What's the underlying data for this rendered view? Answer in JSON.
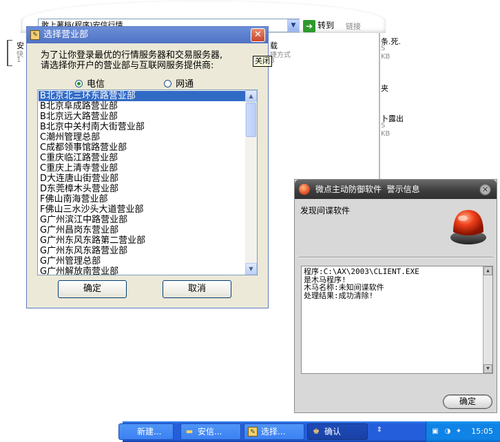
{
  "background": {
    "address_value": "敢上著档(程序)安信行情",
    "go_label": "转到",
    "links_label": "链接",
    "left_text_1": "安",
    "left_text_2": "快",
    "left_text_3": "1",
    "mid_text_1": "载",
    "mid_text_2": "捷方式",
    "mid_text_3": "B",
    "right_text_1": "条.死.",
    "right_text_1_sub": "S",
    "right_text_1_sub2": "KB",
    "right_text_2": "夹",
    "right_text_3": "卜露出",
    "right_text_3_sub": "S",
    "right_text_3_sub2": "KB"
  },
  "dialog": {
    "title": "选择营业部",
    "close_tooltip": "关闭",
    "prompt_line1": "为了让你登录最优的行情服务器和交易服务器,",
    "prompt_line2": "请选择你开户的营业部与互联网服务提供商:",
    "isp_options": [
      "电信",
      "网通"
    ],
    "isp_selected": "电信",
    "branches": [
      "B北京北三环东路营业部",
      "B北京阜成路营业部",
      "B北京远大路营业部",
      "B北京中关村南大街营业部",
      "C潮州管理总部",
      "C成都领事馆路营业部",
      "C重庆临江路营业部",
      "C重庆上清寺营业部",
      "D大连唐山街营业部",
      "D东莞樟木头营业部",
      "F佛山南海营业部",
      "F佛山三水沙头大道营业部",
      "G广州滨江中路营业部",
      "G广州昌岗东营业部",
      "G广州东风东路第二营业部",
      "G广州东风东路营业部",
      "G广州管理总部",
      "G广州解放南营业部"
    ],
    "selected_branch_index": 0,
    "ok_label": "确定",
    "cancel_label": "取消"
  },
  "alert": {
    "title": "微点主动防御软件  警示信息",
    "heading": "发现间谍软件",
    "lines": [
      "程序:C:\\AX\\2003\\CLIENT.EXE",
      "是木马程序!",
      "木马名称:未知间谍软件",
      "处理结果:成功清除!"
    ],
    "ok_label": "确定"
  },
  "taskbar": {
    "buttons": [
      {
        "label": "新建...",
        "icon": "ie-icon"
      },
      {
        "label": "安信...",
        "icon": "folder-icon"
      },
      {
        "label": "选择...",
        "icon": "app-icon"
      },
      {
        "label": "确认",
        "icon": "confirm-icon"
      }
    ],
    "clock": "15:05"
  }
}
